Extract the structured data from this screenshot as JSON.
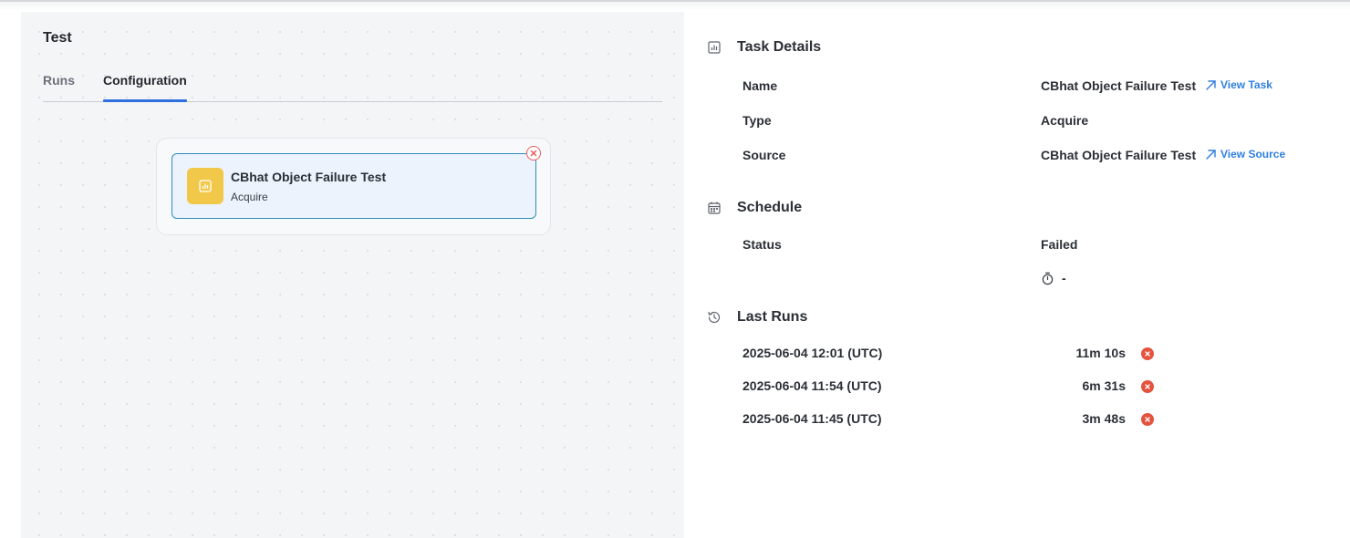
{
  "flow": {
    "title": "Test",
    "tabs": [
      "Runs",
      "Configuration"
    ],
    "active_tab": "Configuration"
  },
  "node": {
    "title": "CBhat Object Failure Test",
    "subtitle": "Acquire",
    "icon": "chart-icon",
    "icon_color": "#f2c84b"
  },
  "task_details": {
    "heading": "Task Details",
    "name_label": "Name",
    "name_value": "CBhat Object Failure Test",
    "view_task": "View Task",
    "type_label": "Type",
    "type_value": "Acquire",
    "source_label": "Source",
    "source_value": "CBhat Object Failure Test",
    "view_source": "View Source"
  },
  "schedule": {
    "heading": "Schedule",
    "status_label": "Status",
    "status_value": "Failed",
    "timer_value": "-"
  },
  "last_runs": {
    "heading": "Last Runs",
    "runs": [
      {
        "date": "2025-06-04 12:01 (UTC)",
        "duration": "11m 10s",
        "status": "failed"
      },
      {
        "date": "2025-06-04 11:54 (UTC)",
        "duration": "6m 31s",
        "status": "failed"
      },
      {
        "date": "2025-06-04 11:45 (UTC)",
        "duration": "3m 48s",
        "status": "failed"
      }
    ]
  },
  "colors": {
    "accent": "#2f6fe0",
    "link": "#2f7fe0",
    "error": "#e5533f",
    "node_border": "#2c8fb8"
  }
}
